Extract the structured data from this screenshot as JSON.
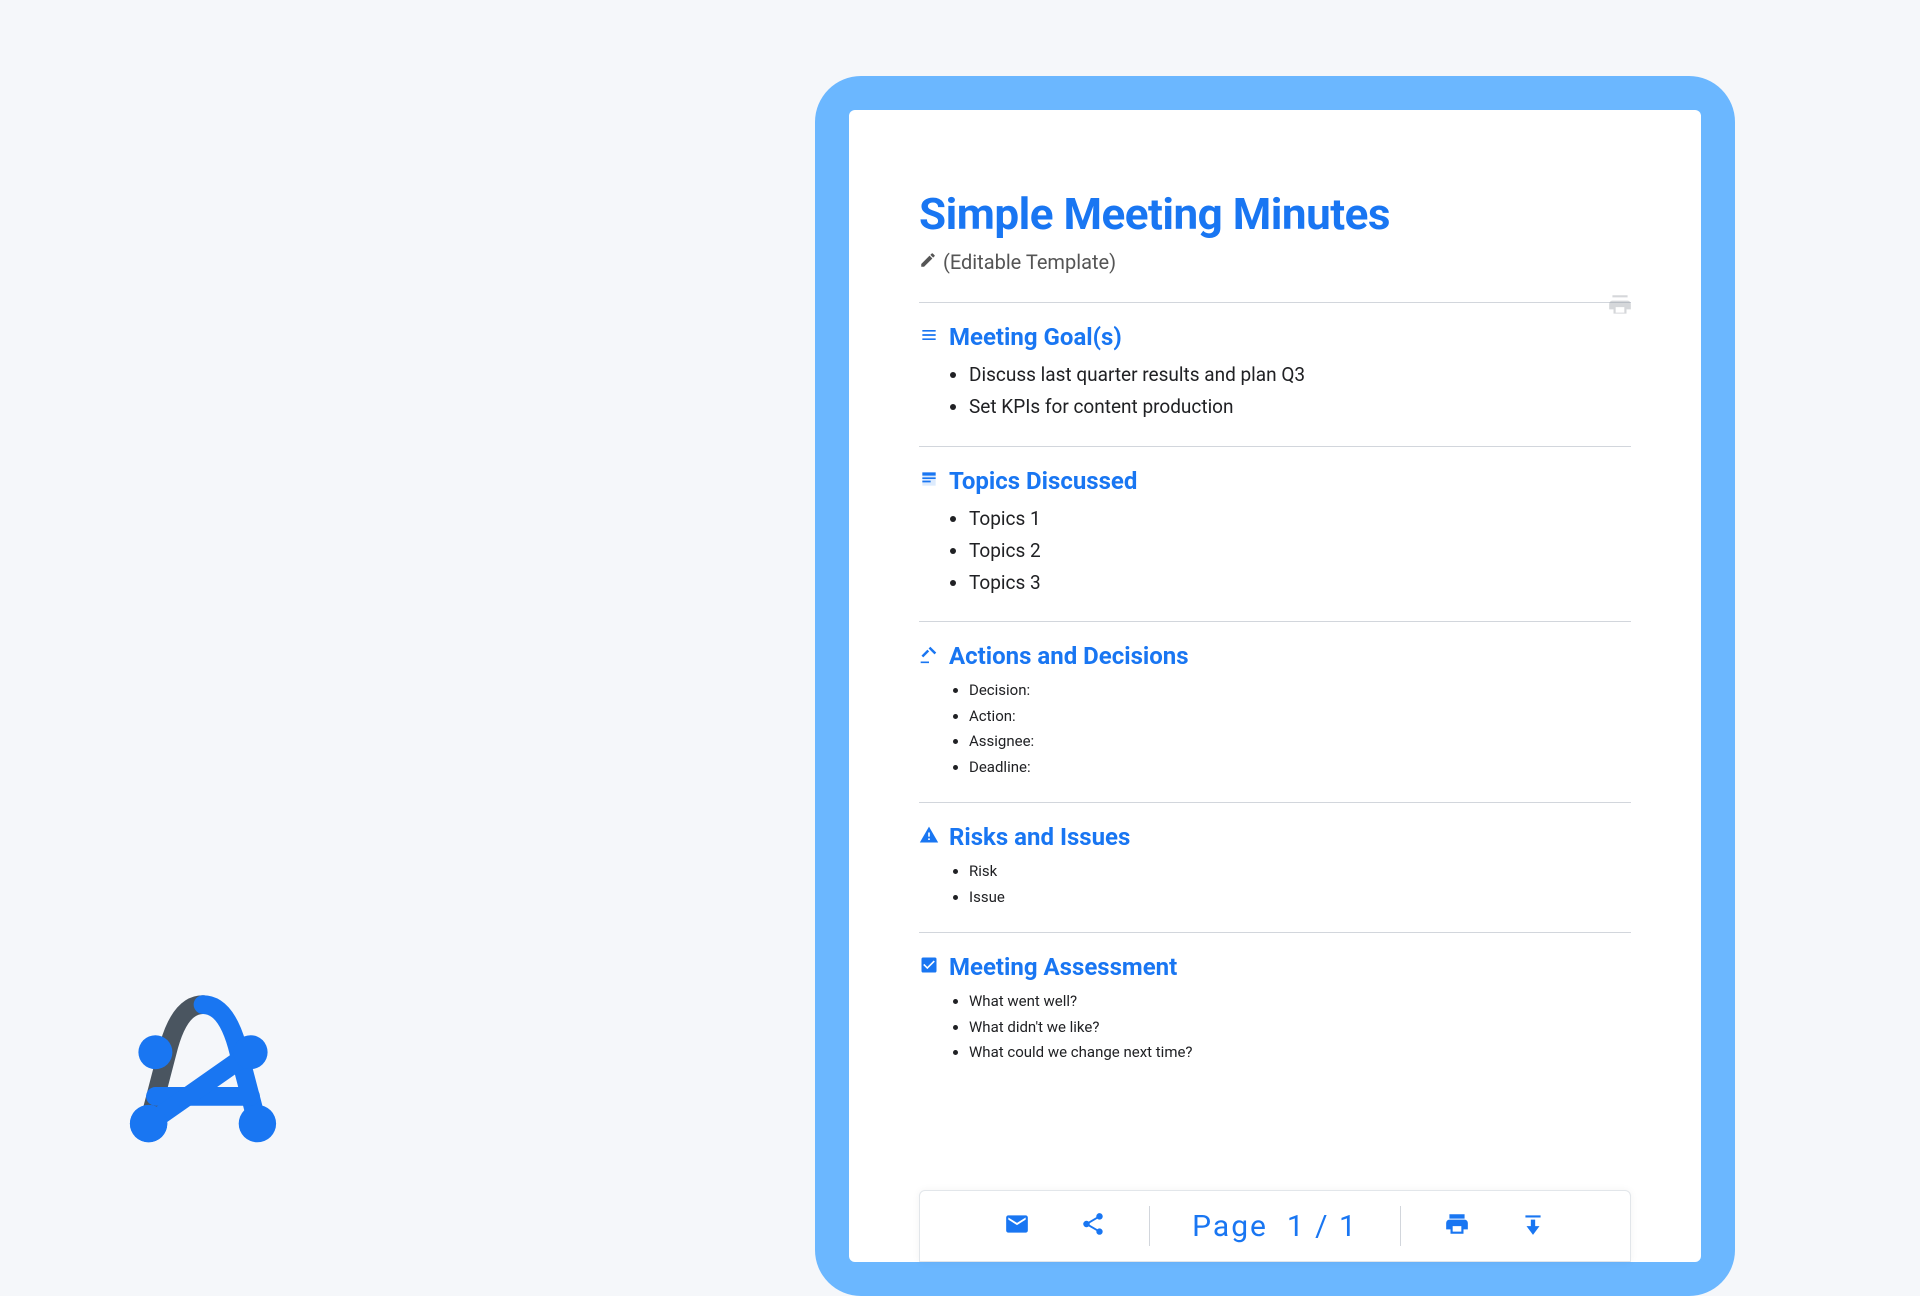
{
  "colors": {
    "accent": "#1976f2",
    "frame": "#6bb7ff",
    "text": "#202124",
    "muted": "#555"
  },
  "document": {
    "title": "Simple Meeting Minutes",
    "subtitle": "(Editable Template)"
  },
  "sections": {
    "goals": {
      "heading": "Meeting Goal(s)",
      "items": [
        "Discuss last quarter results and plan Q3",
        "Set KPIs for content production"
      ]
    },
    "topics": {
      "heading": "Topics Discussed",
      "items": [
        "Topics 1",
        "Topics 2",
        "Topics 3"
      ]
    },
    "actions": {
      "heading": "Actions and Decisions",
      "items": [
        "Decision:",
        "Action:",
        "Assignee:",
        "Deadline:"
      ]
    },
    "risks": {
      "heading": "Risks and Issues",
      "items": [
        "Risk",
        "Issue"
      ]
    },
    "assessment": {
      "heading": "Meeting Assessment",
      "items": [
        "What went well?",
        "What didn't we like?",
        "What could we change next time?"
      ]
    }
  },
  "toolbar": {
    "mail": "mail-icon",
    "share": "share-icon",
    "print": "print-icon",
    "download": "download-icon",
    "page_label": "Page",
    "page_current": "1",
    "page_sep": "/",
    "page_total": "1"
  }
}
